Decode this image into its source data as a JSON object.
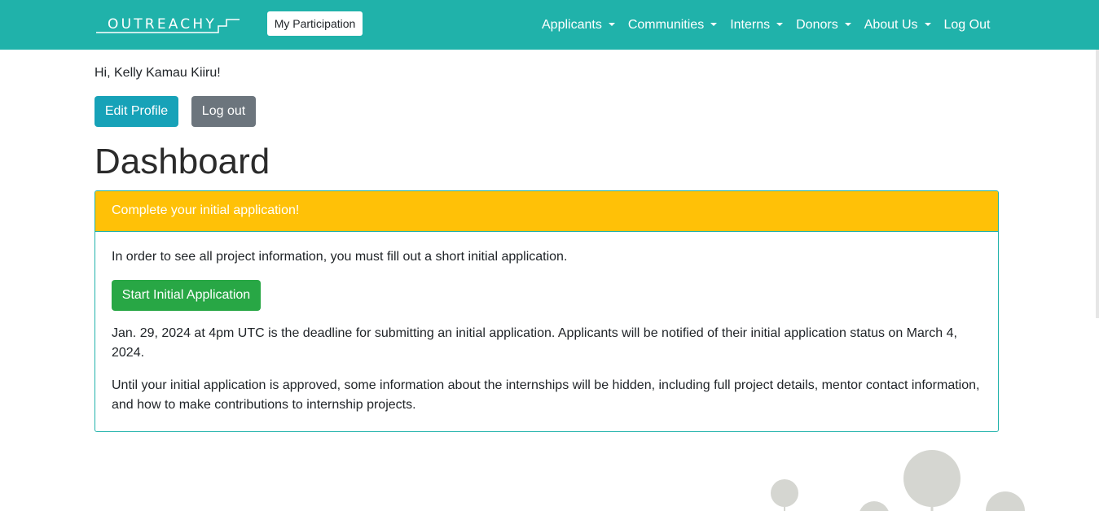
{
  "header": {
    "logo_text": "OUTREACHY",
    "participation_label": "My Participation",
    "nav": [
      {
        "label": "Applicants",
        "dropdown": true
      },
      {
        "label": "Communities",
        "dropdown": true
      },
      {
        "label": "Interns",
        "dropdown": true
      },
      {
        "label": "Donors",
        "dropdown": true
      },
      {
        "label": "About Us",
        "dropdown": true
      },
      {
        "label": "Log Out",
        "dropdown": false
      }
    ]
  },
  "main": {
    "greeting": "Hi, Kelly Kamau Kiiru!",
    "edit_profile_label": "Edit Profile",
    "logout_label": "Log out",
    "title": "Dashboard",
    "card": {
      "header": "Complete your initial application!",
      "intro": "In order to see all project information, you must fill out a short initial application.",
      "start_label": "Start Initial Application",
      "deadline_text": "Jan. 29, 2024 at 4pm UTC is the deadline for submitting an initial application. Applicants will be notified of their initial application status on March 4, 2024.",
      "hidden_info_text": "Until your initial application is approved, some information about the internships will be hidden, including full project details, mentor contact information, and how to make contributions to internship projects."
    }
  },
  "colors": {
    "brand": "#20b2aa",
    "warning": "#ffc107",
    "success": "#28a745",
    "info": "#17a2b8",
    "secondary": "#6c757d"
  },
  "icons": {
    "logo_mark": "outreachy-stairs-logo",
    "dropdown": "caret-down-icon",
    "decoration": "balloons-illustration"
  }
}
